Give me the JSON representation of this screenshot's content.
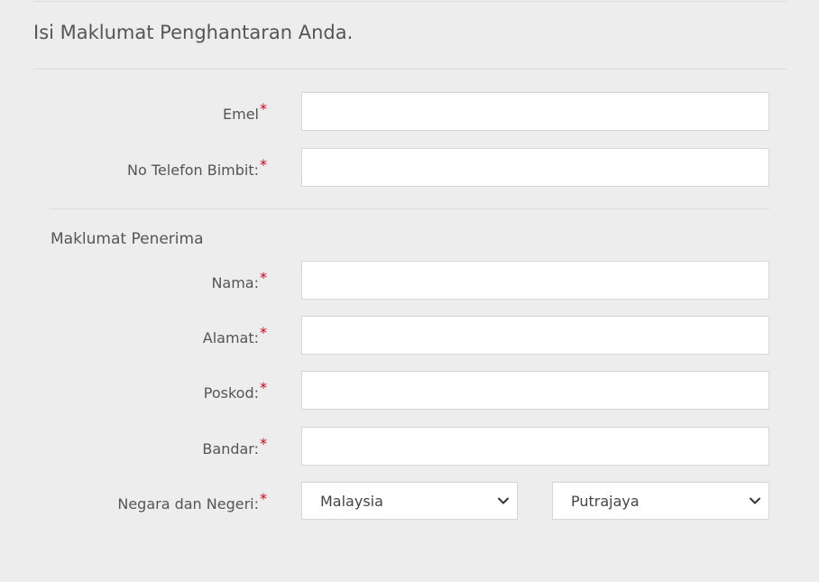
{
  "page": {
    "title": "Isi Maklumat Penghantaran Anda."
  },
  "contact": {
    "email_label": "Emel",
    "email_value": "",
    "phone_label": "No Telefon Bimbit:",
    "phone_value": ""
  },
  "recipient": {
    "section_title": "Maklumat Penerima",
    "name_label": "Nama:",
    "name_value": "",
    "address_label": "Alamat:",
    "address_value": "",
    "postcode_label": "Poskod:",
    "postcode_value": "",
    "city_label": "Bandar:",
    "city_value": "",
    "country_state_label": "Negara dan Negeri:",
    "country_selected": "Malaysia",
    "state_selected": "Putrajaya"
  },
  "required_marker": "*",
  "icons": {
    "select_arrow": "chevron-down-icon"
  },
  "colors": {
    "background": "#ededed",
    "required": "#d0021b",
    "field_border": "#d6d6d6",
    "text": "#555555"
  }
}
